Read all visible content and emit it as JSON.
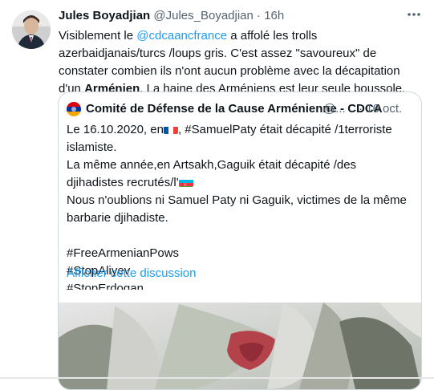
{
  "tweet": {
    "name": "Jules Boyadjian",
    "handle": "@Jules_Boyadjian",
    "separator": "·",
    "time": "16h",
    "text_part1": "Visiblement le ",
    "mention": "@cdcaancfrance",
    "text_part2": " a affolé les trolls azerbaidjanais/turcs /loups gris. C'est assez \"savoureux\" de constater combien ils n'ont aucun problème avec la décapitation d'un ",
    "bold_word": "Arménien",
    "text_part3": ". La haine des Arméniens est leur seule boussole."
  },
  "quote": {
    "name": "Comité de Défense de la Cause Arménienne - CDCA",
    "handle": "@...",
    "separator": "·",
    "time": "16 oct.",
    "line1_a": "Le 16.10.2020, en",
    "line1_b": ", #SamuelPaty était décapité /1terroriste islamiste.",
    "line2_a": "La même année,en Artsakh,Gaguik était décapité /des djihadistes recrutés/",
    "line2_b": "l'",
    "line3": "Nous n'oublions ni Samuel Paty ni Gaguik, victimes de la même barbarie djihadiste.",
    "hashtags": [
      "#FreeArmenianPows",
      "#StopAliyev",
      "#StopErdogan"
    ],
    "show_thread": "Afficher cette discussion"
  },
  "icons": {
    "more": "more-options-icon",
    "flag_fr": "flag-france-icon",
    "flag_az": "flag-azerbaijan-icon"
  },
  "colors": {
    "link": "#1d9bf0",
    "secondary": "#536471",
    "border": "#cfd9de"
  }
}
